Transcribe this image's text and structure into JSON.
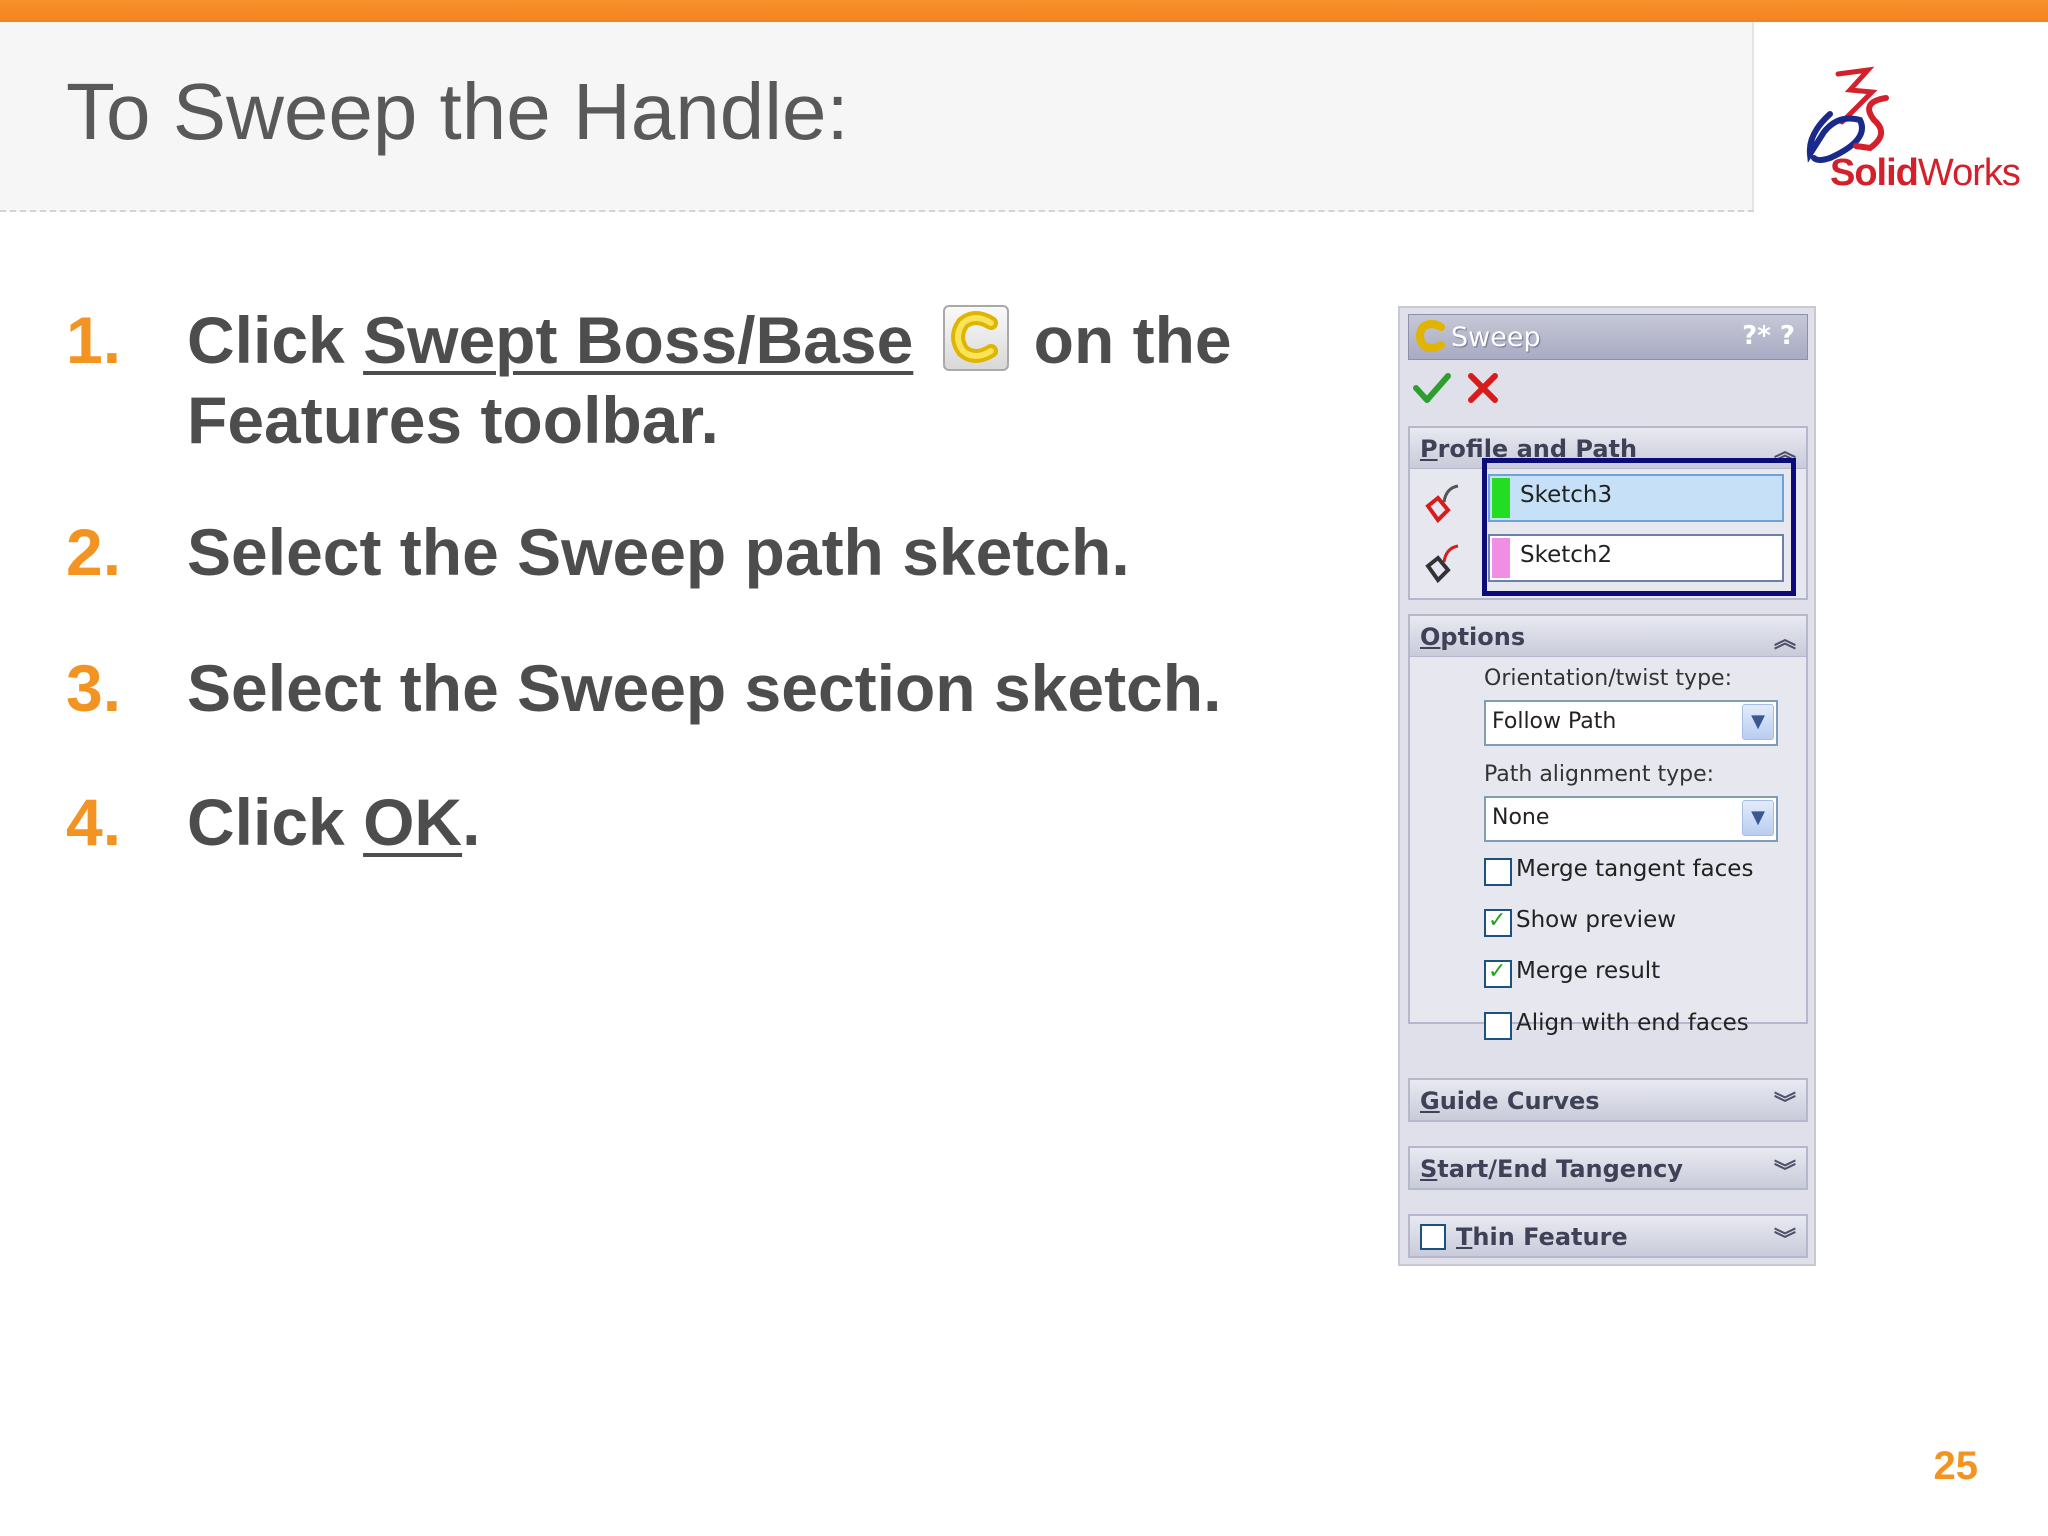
{
  "slide": {
    "title": "To Sweep the Handle:",
    "page_number": "25",
    "logo": {
      "brand_bold": "Solid",
      "brand_regular": "Works"
    }
  },
  "steps": [
    {
      "num": "1.",
      "pre": "Click ",
      "link": "Swept Boss/Base",
      "post": "on the Features toolbar."
    },
    {
      "num": "2.",
      "text": "Select the Sweep path sketch."
    },
    {
      "num": "3.",
      "text": "Select the Sweep section sketch."
    },
    {
      "num": "4.",
      "pre": "Click ",
      "link": "OK",
      "post": "."
    }
  ],
  "panel": {
    "title": "Sweep",
    "header_icons": [
      "?*",
      "?"
    ],
    "profile_path": {
      "title": "Profile and Path",
      "profile_value": "Sketch3",
      "path_value": "Sketch2",
      "colors": {
        "profile": "#22dd22",
        "path": "#f08ee6"
      }
    },
    "options": {
      "title": "Options",
      "orientation_label": "Orientation/twist type:",
      "orientation_value": "Follow Path",
      "path_alignment_label": "Path alignment type:",
      "path_alignment_value": "None",
      "checkboxes": [
        {
          "label": "Merge tangent faces",
          "checked": false
        },
        {
          "label": "Show preview",
          "checked": true
        },
        {
          "label": "Merge result",
          "checked": true
        },
        {
          "label": "Align with end faces",
          "checked": false
        }
      ]
    },
    "guide_curves": {
      "title": "Guide Curves"
    },
    "tangency": {
      "title": "Start/End Tangency"
    },
    "thin_feature": {
      "title": "Thin Feature",
      "checked": false
    }
  },
  "colors": {
    "accent_orange": "#f39321",
    "title_gray": "#595959",
    "selection_frame": "#0b0b7a"
  },
  "icons": [
    "swept-boss-base-icon",
    "ok-check-icon",
    "cancel-x-icon",
    "help-icon",
    "collapse-chevron-icon",
    "expand-chevron-icon",
    "profile-icon",
    "path-icon",
    "dropdown-arrow-icon",
    "solidworks-logo"
  ]
}
